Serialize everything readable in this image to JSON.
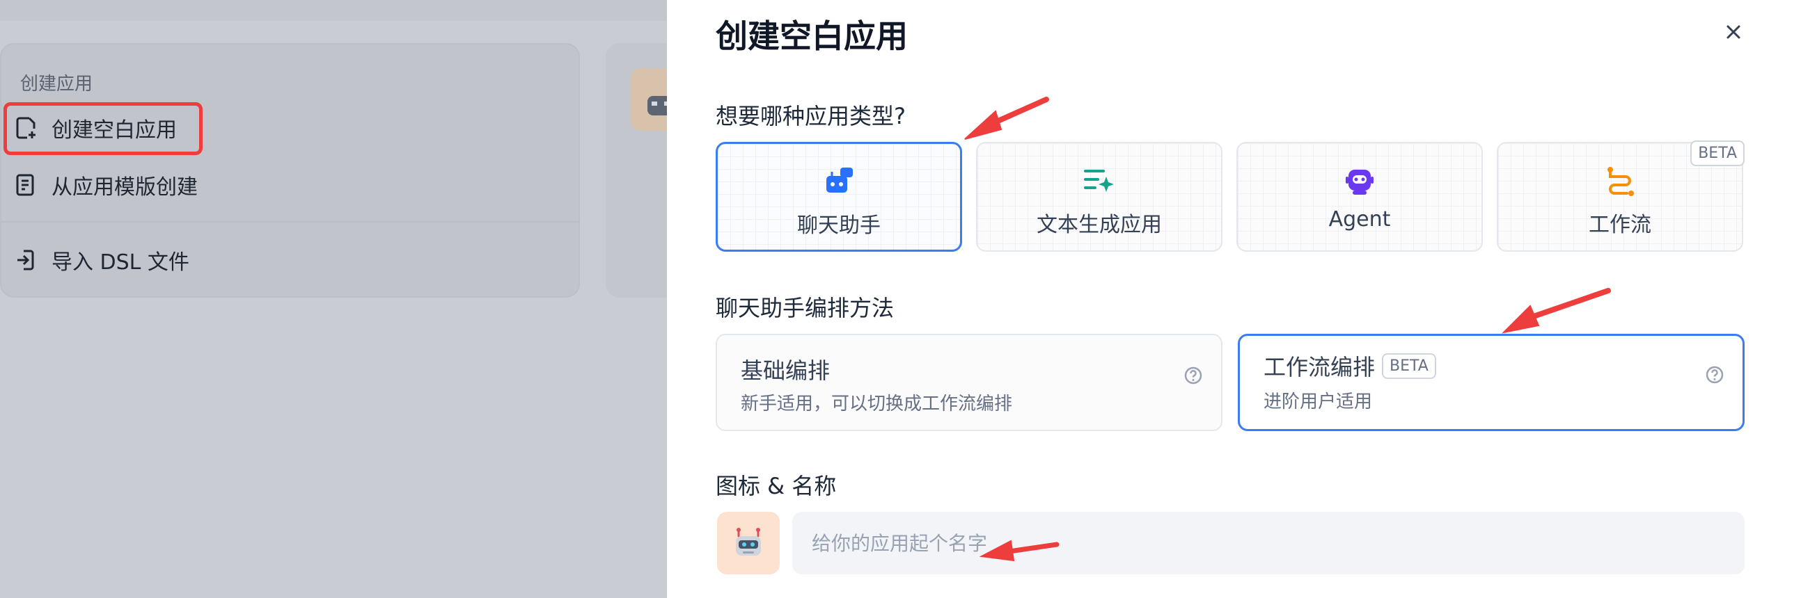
{
  "background_menu": {
    "heading": "创建应用",
    "items": [
      {
        "label": "创建空白应用",
        "icon": "file-plus-icon"
      },
      {
        "label": "从应用模版创建",
        "icon": "template-icon"
      },
      {
        "label": "导入 DSL 文件",
        "icon": "import-icon"
      }
    ],
    "highlight_color": "#ee3d3d"
  },
  "modal": {
    "title": "创建空白应用",
    "close_icon": "close-icon",
    "type_section_label": "想要哪种应用类型?",
    "app_types": [
      {
        "label": "聊天助手",
        "icon": "chat-bot-icon",
        "selected": true
      },
      {
        "label": "文本生成应用",
        "icon": "text-generation-icon",
        "selected": false
      },
      {
        "label": "Agent",
        "icon": "agent-robot-icon",
        "selected": false
      },
      {
        "label": "工作流",
        "icon": "workflow-icon",
        "selected": false,
        "badge": "BETA"
      }
    ],
    "mode_section_label": "聊天助手编排方法",
    "modes": [
      {
        "title": "基础编排",
        "desc": "新手适用，可以切换成工作流编排",
        "selected": false
      },
      {
        "title": "工作流编排",
        "badge": "BETA",
        "desc": "进阶用户适用",
        "selected": true
      }
    ],
    "name_section_label": "图标 & 名称",
    "name_input": {
      "value": "",
      "placeholder": "给你的应用起个名字"
    }
  },
  "colors": {
    "accent": "#3b7cf0",
    "annotation_arrow": "#ee3d3d"
  }
}
